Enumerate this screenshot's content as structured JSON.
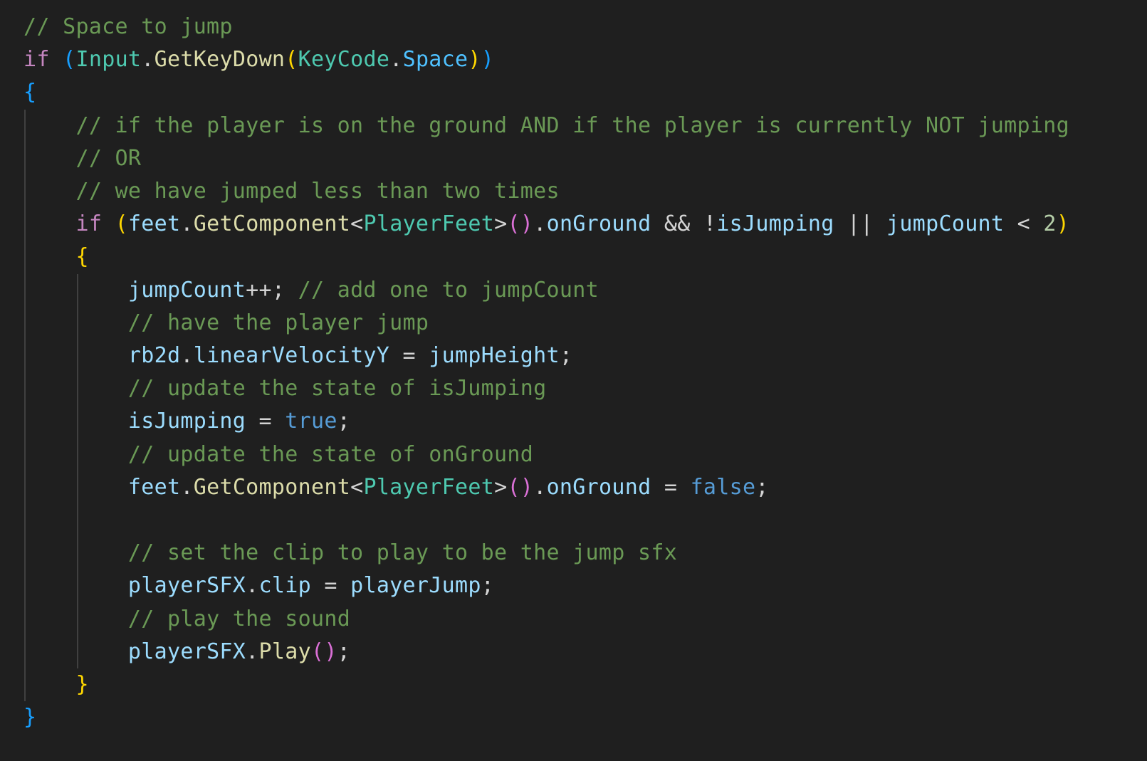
{
  "colors": {
    "background": "#1f1f1f",
    "default": "#d4d4d4",
    "comment": "#6a9955",
    "keyword": "#c586c0",
    "variable": "#9cdcfe",
    "function": "#dcdcaa",
    "type": "#4ec9b0",
    "constant": "#4fc1ff",
    "literal": "#569cd6",
    "number": "#b5cea8",
    "bracket1": "#ffd700",
    "bracket2": "#da70d6",
    "bracket3": "#179fff",
    "guide": "#404040"
  },
  "lines": [
    [
      {
        "t": "// Space to jump",
        "c": "comment"
      }
    ],
    [
      {
        "t": "if",
        "c": "keyword"
      },
      {
        "t": " ",
        "c": "default"
      },
      {
        "t": "(",
        "c": "bracket3"
      },
      {
        "t": "Input",
        "c": "type"
      },
      {
        "t": ".",
        "c": "default"
      },
      {
        "t": "GetKeyDown",
        "c": "function"
      },
      {
        "t": "(",
        "c": "bracket1"
      },
      {
        "t": "KeyCode",
        "c": "type"
      },
      {
        "t": ".",
        "c": "default"
      },
      {
        "t": "Space",
        "c": "constant"
      },
      {
        "t": ")",
        "c": "bracket1"
      },
      {
        "t": ")",
        "c": "bracket3"
      }
    ],
    [
      {
        "t": "{",
        "c": "bracket3"
      }
    ],
    [
      {
        "t": "    ",
        "c": "default"
      },
      {
        "t": "// if the player is on the ground AND if the player is currently NOT jumping",
        "c": "comment"
      }
    ],
    [
      {
        "t": "    ",
        "c": "default"
      },
      {
        "t": "// OR",
        "c": "comment"
      }
    ],
    [
      {
        "t": "    ",
        "c": "default"
      },
      {
        "t": "// we have jumped less than two times",
        "c": "comment"
      }
    ],
    [
      {
        "t": "    ",
        "c": "default"
      },
      {
        "t": "if",
        "c": "keyword"
      },
      {
        "t": " ",
        "c": "default"
      },
      {
        "t": "(",
        "c": "bracket1"
      },
      {
        "t": "feet",
        "c": "variable"
      },
      {
        "t": ".",
        "c": "default"
      },
      {
        "t": "GetComponent",
        "c": "function"
      },
      {
        "t": "<",
        "c": "default"
      },
      {
        "t": "PlayerFeet",
        "c": "type"
      },
      {
        "t": ">",
        "c": "default"
      },
      {
        "t": "()",
        "c": "bracket2"
      },
      {
        "t": ".",
        "c": "default"
      },
      {
        "t": "onGround",
        "c": "variable"
      },
      {
        "t": " && !",
        "c": "default"
      },
      {
        "t": "isJumping",
        "c": "variable"
      },
      {
        "t": " || ",
        "c": "default"
      },
      {
        "t": "jumpCount",
        "c": "variable"
      },
      {
        "t": " < ",
        "c": "default"
      },
      {
        "t": "2",
        "c": "number"
      },
      {
        "t": ")",
        "c": "bracket1"
      }
    ],
    [
      {
        "t": "    ",
        "c": "default"
      },
      {
        "t": "{",
        "c": "bracket1"
      }
    ],
    [
      {
        "t": "        ",
        "c": "default"
      },
      {
        "t": "jumpCount",
        "c": "variable"
      },
      {
        "t": "++; ",
        "c": "default"
      },
      {
        "t": "// add one to jumpCount",
        "c": "comment"
      }
    ],
    [
      {
        "t": "        ",
        "c": "default"
      },
      {
        "t": "// have the player jump",
        "c": "comment"
      }
    ],
    [
      {
        "t": "        ",
        "c": "default"
      },
      {
        "t": "rb2d",
        "c": "variable"
      },
      {
        "t": ".",
        "c": "default"
      },
      {
        "t": "linearVelocityY",
        "c": "variable"
      },
      {
        "t": " = ",
        "c": "default"
      },
      {
        "t": "jumpHeight",
        "c": "variable"
      },
      {
        "t": ";",
        "c": "default"
      }
    ],
    [
      {
        "t": "        ",
        "c": "default"
      },
      {
        "t": "// update the state of isJumping",
        "c": "comment"
      }
    ],
    [
      {
        "t": "        ",
        "c": "default"
      },
      {
        "t": "isJumping",
        "c": "variable"
      },
      {
        "t": " = ",
        "c": "default"
      },
      {
        "t": "true",
        "c": "literal"
      },
      {
        "t": ";",
        "c": "default"
      }
    ],
    [
      {
        "t": "        ",
        "c": "default"
      },
      {
        "t": "// update the state of onGround",
        "c": "comment"
      }
    ],
    [
      {
        "t": "        ",
        "c": "default"
      },
      {
        "t": "feet",
        "c": "variable"
      },
      {
        "t": ".",
        "c": "default"
      },
      {
        "t": "GetComponent",
        "c": "function"
      },
      {
        "t": "<",
        "c": "default"
      },
      {
        "t": "PlayerFeet",
        "c": "type"
      },
      {
        "t": ">",
        "c": "default"
      },
      {
        "t": "()",
        "c": "bracket2"
      },
      {
        "t": ".",
        "c": "default"
      },
      {
        "t": "onGround",
        "c": "variable"
      },
      {
        "t": " = ",
        "c": "default"
      },
      {
        "t": "false",
        "c": "literal"
      },
      {
        "t": ";",
        "c": "default"
      }
    ],
    [],
    [
      {
        "t": "        ",
        "c": "default"
      },
      {
        "t": "// set the clip to play to be the jump sfx",
        "c": "comment"
      }
    ],
    [
      {
        "t": "        ",
        "c": "default"
      },
      {
        "t": "playerSFX",
        "c": "variable"
      },
      {
        "t": ".",
        "c": "default"
      },
      {
        "t": "clip",
        "c": "variable"
      },
      {
        "t": " = ",
        "c": "default"
      },
      {
        "t": "playerJump",
        "c": "variable"
      },
      {
        "t": ";",
        "c": "default"
      }
    ],
    [
      {
        "t": "        ",
        "c": "default"
      },
      {
        "t": "// play the sound",
        "c": "comment"
      }
    ],
    [
      {
        "t": "        ",
        "c": "default"
      },
      {
        "t": "playerSFX",
        "c": "variable"
      },
      {
        "t": ".",
        "c": "default"
      },
      {
        "t": "Play",
        "c": "function"
      },
      {
        "t": "()",
        "c": "bracket2"
      },
      {
        "t": ";",
        "c": "default"
      }
    ],
    [
      {
        "t": "    ",
        "c": "default"
      },
      {
        "t": "}",
        "c": "bracket1"
      }
    ],
    [
      {
        "t": "}",
        "c": "bracket3"
      }
    ]
  ]
}
